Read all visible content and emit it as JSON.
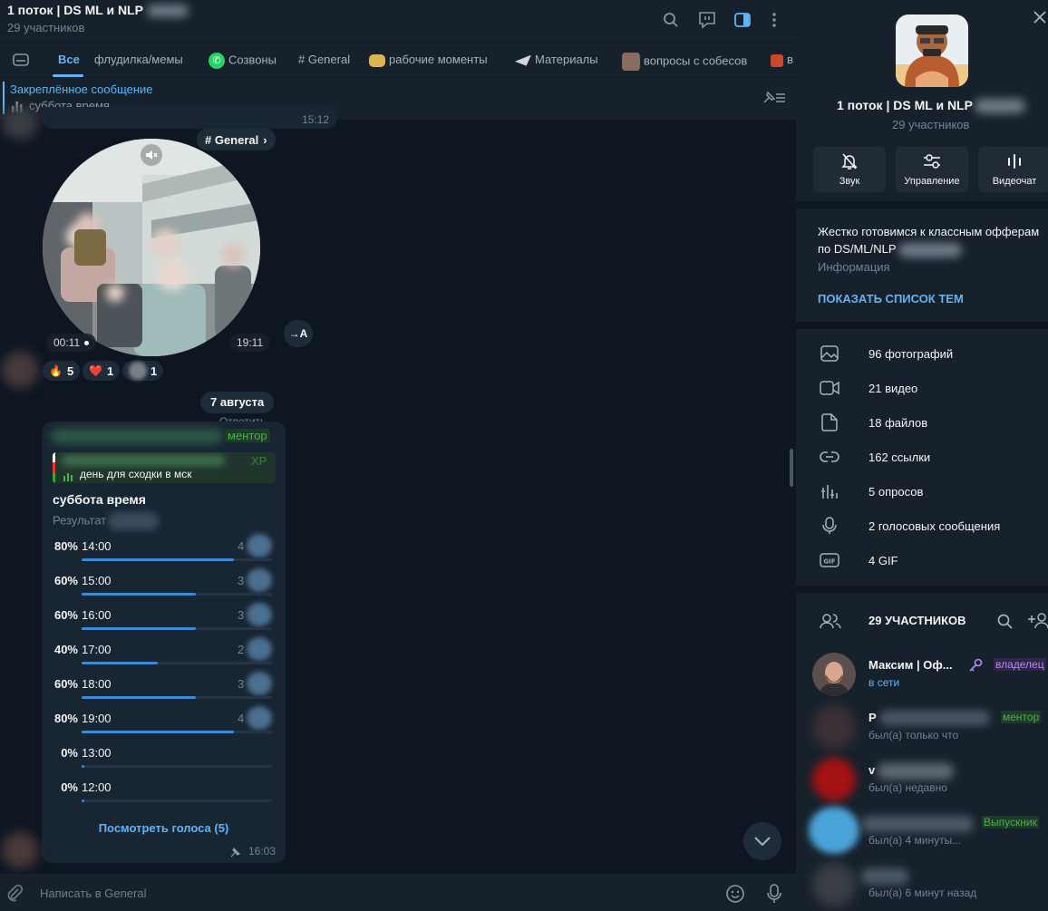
{
  "chat": {
    "title": "1 поток | DS ML и NLP",
    "subtitle": "29 участников",
    "tabs": [
      {
        "label": "Все"
      },
      {
        "label": "флудилка/мемы"
      },
      {
        "label": "Созвоны"
      },
      {
        "label": "# General"
      },
      {
        "label": "рабочие моменты"
      },
      {
        "label": "Материалы"
      },
      {
        "label": "вопросы с собесов"
      },
      {
        "label": "в"
      }
    ],
    "pinned": {
      "title": "Закреплённое сообщение",
      "text": "суббота время"
    },
    "prev_time": "15:12",
    "topic_chip": "# General",
    "video": {
      "duration": "00:11",
      "time": "19:11",
      "forward": "→A"
    },
    "reactions": [
      {
        "emoji": "🔥",
        "count": "5"
      },
      {
        "emoji": "❤️",
        "count": "1"
      },
      {
        "emoji": "",
        "count": "1"
      }
    ],
    "date_chip": "7 августа",
    "reply_hint": "Ответить",
    "poll": {
      "role_badge": "ментор",
      "reply_text": "день для сходки в мск",
      "reply_suffix": "XP",
      "question": "суббота время",
      "results_label": "Результат",
      "options": [
        {
          "pct": "80%",
          "label": "14:00",
          "count": "4",
          "fraction": 0.8
        },
        {
          "pct": "60%",
          "label": "15:00",
          "count": "3",
          "fraction": 0.6
        },
        {
          "pct": "60%",
          "label": "16:00",
          "count": "3",
          "fraction": 0.6
        },
        {
          "pct": "40%",
          "label": "17:00",
          "count": "2",
          "fraction": 0.4
        },
        {
          "pct": "60%",
          "label": "18:00",
          "count": "3",
          "fraction": 0.6
        },
        {
          "pct": "80%",
          "label": "19:00",
          "count": "4",
          "fraction": 0.8
        },
        {
          "pct": "0%",
          "label": "13:00",
          "count": "",
          "fraction": 0
        },
        {
          "pct": "0%",
          "label": "12:00",
          "count": "",
          "fraction": 0
        }
      ],
      "view_votes": "Посмотреть голоса (5)",
      "time": "16:03"
    },
    "input_placeholder": "Написать в General"
  },
  "sidebar": {
    "group_name": "1 поток | DS ML и NLP",
    "member_count": "29 участников",
    "actions": [
      {
        "label": "Звук",
        "icon": "bell-off-icon"
      },
      {
        "label": "Управление",
        "icon": "sliders-icon"
      },
      {
        "label": "Видеочат",
        "icon": "voice-chat-icon"
      }
    ],
    "description": "Жестко готовимся к классным офферам по DS/ML/NLP",
    "info_label": "Информация",
    "show_topics": "ПОКАЗАТЬ СПИСОК ТЕМ",
    "media": [
      {
        "label": "96 фотографий",
        "icon": "photo-icon"
      },
      {
        "label": "21 видео",
        "icon": "video-icon"
      },
      {
        "label": "18 файлов",
        "icon": "file-icon"
      },
      {
        "label": "162 ссылки",
        "icon": "link-icon"
      },
      {
        "label": "5 опросов",
        "icon": "poll-icon"
      },
      {
        "label": "2 голосовых сообщения",
        "icon": "mic-icon"
      },
      {
        "label": "4 GIF",
        "icon": "gif-icon"
      }
    ],
    "members_header": "29 УЧАСТНИКОВ",
    "members": [
      {
        "name": "Максим | Оф...",
        "status": "в сети",
        "badge": "владелец",
        "badge_color": "#b28cf5",
        "status_color": "#5eb5f7",
        "avatar_color": "#6a5a52"
      },
      {
        "name": "Р",
        "status": "был(а) только что",
        "badge": "ментор",
        "badge_color": "#4fae4e",
        "status_color": "#708499",
        "avatar_color": "#3b3036"
      },
      {
        "name": "v",
        "status": "был(а) недавно",
        "badge": "",
        "badge_color": "",
        "status_color": "#708499",
        "avatar_color": "#a41214"
      },
      {
        "name": "",
        "status": "был(а) 4 минуты...",
        "badge": "Выпускник",
        "badge_color": "#4fae4e",
        "status_color": "#708499",
        "avatar_color": "#4aa3d8"
      },
      {
        "name": "",
        "status": "был(а) 6 минут назад",
        "badge": "",
        "badge_color": "",
        "status_color": "#708499",
        "avatar_color": "#3a3f45"
      }
    ]
  }
}
